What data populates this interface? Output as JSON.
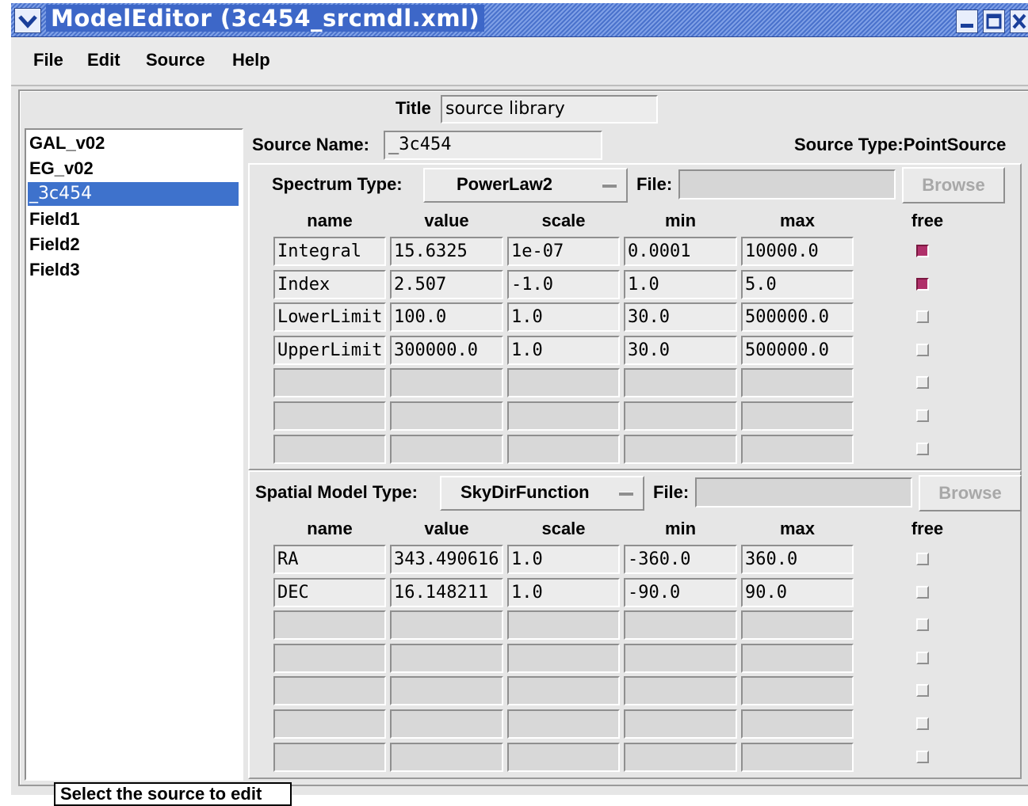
{
  "window": {
    "title": "ModelEditor (3c454_srcmdl.xml)",
    "controls": {
      "minimize": "minimize-icon",
      "maximize": "maximize-icon",
      "close": "close-icon",
      "menu": "chevron-down-icon"
    }
  },
  "menubar": {
    "items": [
      "File",
      "Edit",
      "Source",
      "Help"
    ]
  },
  "title_field": {
    "label": "Title",
    "value": "source library"
  },
  "source_list": {
    "items": [
      "GAL_v02",
      "EG_v02",
      "_3c454",
      "Field1",
      "Field2",
      "Field3"
    ],
    "selected": "_3c454"
  },
  "source": {
    "name_label": "Source Name:",
    "name_value": "_3c454",
    "type_text": "Source Type:PointSource"
  },
  "spectrum": {
    "type_label": "Spectrum Type:",
    "type_value": "PowerLaw2",
    "file_label": "File:",
    "file_value": "",
    "browse_label": "Browse",
    "columns": [
      "name",
      "value",
      "scale",
      "min",
      "max",
      "free"
    ],
    "rows": [
      {
        "name": "Integral",
        "value": "15.6325",
        "scale": "1e-07",
        "min": "0.0001",
        "max": "10000.0",
        "free": true
      },
      {
        "name": "Index",
        "value": "2.507",
        "scale": "-1.0",
        "min": "1.0",
        "max": "5.0",
        "free": true
      },
      {
        "name": "LowerLimit",
        "value": "100.0",
        "scale": "1.0",
        "min": "30.0",
        "max": "500000.0",
        "free": false
      },
      {
        "name": "UpperLimit",
        "value": "300000.0",
        "scale": "1.0",
        "min": "30.0",
        "max": "500000.0",
        "free": false
      },
      {
        "name": "",
        "value": "",
        "scale": "",
        "min": "",
        "max": "",
        "free": false
      },
      {
        "name": "",
        "value": "",
        "scale": "",
        "min": "",
        "max": "",
        "free": false
      },
      {
        "name": "",
        "value": "",
        "scale": "",
        "min": "",
        "max": "",
        "free": false
      }
    ]
  },
  "spatial": {
    "type_label": "Spatial Model Type:",
    "type_value": "SkyDirFunction",
    "file_label": "File:",
    "file_value": "",
    "browse_label": "Browse",
    "columns": [
      "name",
      "value",
      "scale",
      "min",
      "max",
      "free"
    ],
    "rows": [
      {
        "name": "RA",
        "value": "343.490616",
        "scale": "1.0",
        "min": "-360.0",
        "max": "360.0",
        "free": false
      },
      {
        "name": "DEC",
        "value": "16.148211",
        "scale": "1.0",
        "min": "-90.0",
        "max": "90.0",
        "free": false
      },
      {
        "name": "",
        "value": "",
        "scale": "",
        "min": "",
        "max": "",
        "free": false
      },
      {
        "name": "",
        "value": "",
        "scale": "",
        "min": "",
        "max": "",
        "free": false
      },
      {
        "name": "",
        "value": "",
        "scale": "",
        "min": "",
        "max": "",
        "free": false
      },
      {
        "name": "",
        "value": "",
        "scale": "",
        "min": "",
        "max": "",
        "free": false
      },
      {
        "name": "",
        "value": "",
        "scale": "",
        "min": "",
        "max": "",
        "free": false
      }
    ]
  },
  "tooltip": "Select the source to edit",
  "colors": {
    "selection": "#3e72cc",
    "checked": "#b0306a",
    "titlebar": "#4a72cc"
  }
}
